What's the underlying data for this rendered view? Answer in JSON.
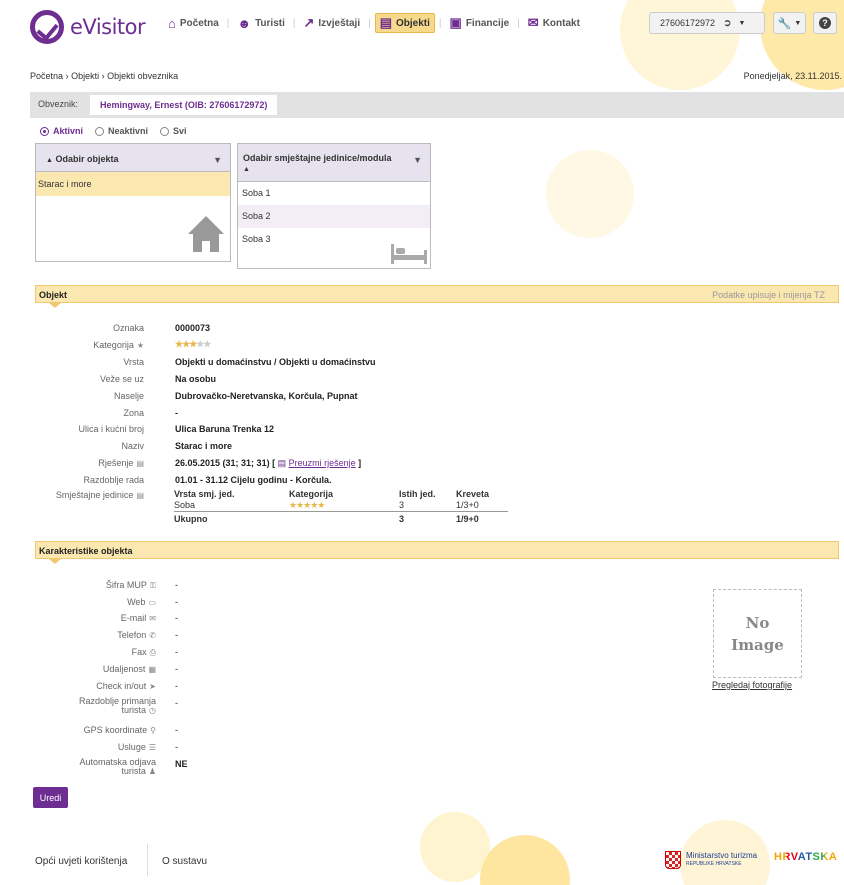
{
  "header": {
    "logo_text": "eVisitor",
    "nav": [
      {
        "label": "Početna",
        "icon": "home-icon",
        "active": false
      },
      {
        "label": "Turisti",
        "icon": "users-icon",
        "active": false
      },
      {
        "label": "Izvještaji",
        "icon": "chart-icon",
        "active": false
      },
      {
        "label": "Objekti",
        "icon": "bed-icon",
        "active": true
      },
      {
        "label": "Financije",
        "icon": "money-icon",
        "active": false
      },
      {
        "label": "Kontakt",
        "icon": "envelope-icon",
        "active": false
      }
    ],
    "user_id": "27606172972"
  },
  "breadcrumb": {
    "items": [
      "Početna",
      "Objekti",
      "Objekti obveznika"
    ],
    "separator": "›"
  },
  "date": "Ponedjeljak, 23.11.2015.",
  "obveznik": {
    "label": "Obveznik:",
    "value": "Hemingway, Ernest (OIB: 27606172972)"
  },
  "filters": {
    "options": [
      "Aktivni",
      "Neaktivni",
      "Svi"
    ],
    "selected": "Aktivni"
  },
  "object_panel": {
    "header": "Odabir objekta",
    "sort_glyph": "▲",
    "items": [
      "Starac i more"
    ],
    "selected": "Starac i more"
  },
  "unit_panel": {
    "header": "Odabir smještajne jedinice/modula",
    "sort_glyph": "▲",
    "items": [
      "Soba 1",
      "Soba 2",
      "Soba 3"
    ]
  },
  "objekt": {
    "title": "Objekt",
    "note": "Podatke upisuje i mijenja TZ",
    "fields": {
      "oznaka": {
        "label": "Oznaka",
        "value": "0000073"
      },
      "kategorija": {
        "label": "Kategorija",
        "stars": 3,
        "max": 5
      },
      "vrsta": {
        "label": "Vrsta",
        "value": "Objekti u domaćinstvu / Objekti u domaćinstvu"
      },
      "veze": {
        "label": "Veže se uz",
        "value": "Na osobu"
      },
      "naselje": {
        "label": "Naselje",
        "value": "Dubrovačko-Neretvanska, Korčula, Pupnat"
      },
      "zona": {
        "label": "Zona",
        "value": "-"
      },
      "ulica": {
        "label": "Ulica i kućni broj",
        "value": "Ulica Baruna Trenka 12"
      },
      "naziv": {
        "label": "Naziv",
        "value": "Starac i more"
      },
      "rjesenje": {
        "label": "Rješenje",
        "value": "26.05.2015 (31; 31; 31) [",
        "link": "Preuzmi rješenje",
        "close": "]"
      },
      "razdoblje": {
        "label": "Razdoblje rada",
        "value": "01.01 - 31.12 Cijelu godinu - Korčula."
      },
      "jedinice": {
        "label": "Smještajne jedinice"
      }
    },
    "units_table": {
      "headers": [
        "Vrsta smj. jed.",
        "Kategorija",
        "Istih jed.",
        "Kreveta"
      ],
      "rows": [
        {
          "vrsta": "Soba",
          "stars": 5,
          "istih": "3",
          "kreveta": "1/3+0"
        }
      ],
      "total": {
        "label": "Ukupno",
        "istih": "3",
        "kreveta": "1/9+0"
      }
    }
  },
  "karakteristike": {
    "title": "Karakteristike objekta",
    "fields": [
      {
        "label": "Šifra MUP",
        "value": "-"
      },
      {
        "label": "Web",
        "value": "-"
      },
      {
        "label": "E-mail",
        "value": "-"
      },
      {
        "label": "Telefon",
        "value": "-"
      },
      {
        "label": "Fax",
        "value": "-"
      },
      {
        "label": "Udaljenost",
        "value": "-"
      },
      {
        "label": "Check in/out",
        "value": "-"
      },
      {
        "label": "Razdoblje primanja",
        "label2": "turista",
        "value": "-"
      },
      {
        "label": "GPS koordinate",
        "value": "-"
      },
      {
        "label": "Usluge",
        "value": "-"
      },
      {
        "label": "Automatska odjava",
        "label2": "turista",
        "value": "NE"
      }
    ],
    "no_image": [
      "No",
      "Image"
    ],
    "photos_link": "Pregledaj fotografije"
  },
  "edit_label": "Uredi",
  "footer": {
    "terms": "Opći uvjeti korištenja",
    "about": "O sustavu",
    "ministry": "Ministarstvo turizma",
    "ministry_sub": "REPUBLIKE HRVATSKE",
    "hrvatska": "HRVATSKA"
  },
  "colors": {
    "brand": "#6d2d91",
    "accent": "#f6d98a",
    "section_bg": "#fbe7b0"
  }
}
